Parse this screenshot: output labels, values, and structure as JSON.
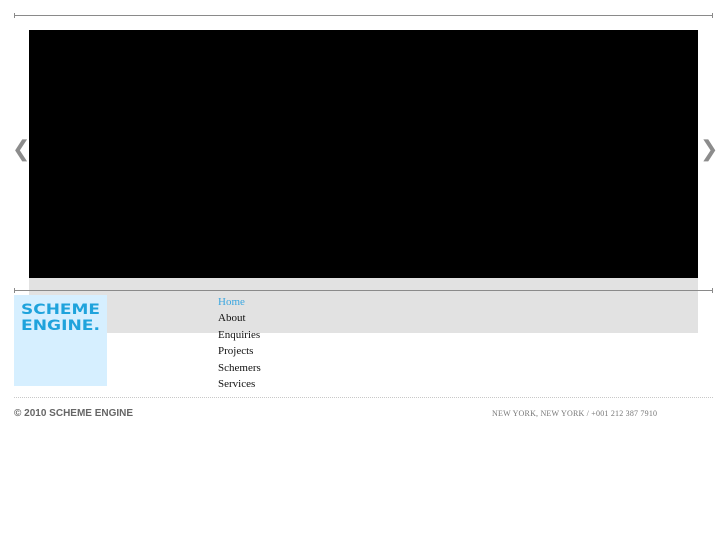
{
  "slideshow": {
    "prev_glyph": "❮",
    "next_glyph": "❯"
  },
  "logo": {
    "line1": "SCHEME",
    "line2": "ENGINE.",
    "color": "#1fa3dc",
    "background": "#d6efff"
  },
  "nav": {
    "items": [
      "Home",
      "About",
      "Enquiries",
      "Projects",
      "Schemers",
      "Services"
    ],
    "active_index": 0,
    "active_color": "#3aa6e0"
  },
  "footer": {
    "copyright": "© 2010 SCHEME ENGINE",
    "contact": "NEW YORK, NEW YORK / +001 212 387 7910"
  }
}
